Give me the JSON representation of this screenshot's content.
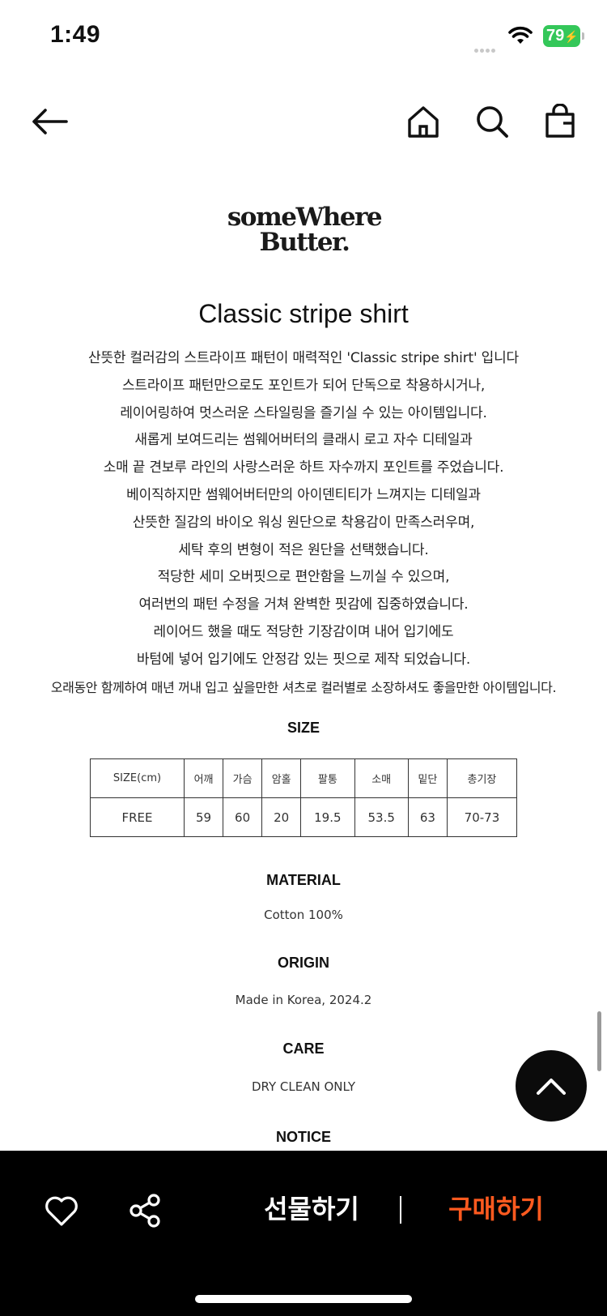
{
  "status": {
    "time": "1:49",
    "battery": "79"
  },
  "nav": {
    "back_icon": "back-arrow-icon",
    "home_icon": "home-icon",
    "search_icon": "search-icon",
    "bag_icon": "shopping-bag-icon"
  },
  "brand": {
    "line1": "someWhere",
    "line2": "Butter."
  },
  "product": {
    "title": "Classic stripe shirt"
  },
  "description": [
    "산뜻한 컬러감의 스트라이프 패턴이 매력적인 'Classic stripe shirt' 입니다",
    "스트라이프 패턴만으로도 포인트가 되어 단독으로 착용하시거나,",
    "레이어링하여 멋스러운 스타일링을 즐기실 수 있는 아이템입니다.",
    "새롭게 보여드리는 썸웨어버터의 클래시 로고 자수 디테일과",
    "소매 끝 견보루 라인의 사랑스러운 하트 자수까지 포인트를 주었습니다.",
    "베이직하지만 썸웨어버터만의 아이덴티티가 느껴지는 디테일과",
    "산뜻한 질감의 바이오 워싱 원단으로 착용감이 만족스러우며,",
    "세탁 후의 변형이 적은 원단을 선택했습니다.",
    "적당한 세미 오버핏으로 편안함을 느끼실 수 있으며,",
    "여러번의 패턴 수정을 거쳐 완벽한 핏감에 집중하였습니다.",
    "레이어드 했을 때도 적당한 기장감이며 내어 입기에도",
    "바텀에 넣어 입기에도 안정감 있는 핏으로 제작 되었습니다.",
    "오래동안 함께하여 매년 꺼내 입고 싶을만한 셔츠로 컬러별로 소장하셔도 좋을만한 아이템입니다."
  ],
  "size": {
    "heading": "SIZE",
    "headers": [
      "SIZE(cm)",
      "어깨",
      "가슴",
      "암홀",
      "팔통",
      "소매",
      "밑단",
      "총기장"
    ],
    "row": [
      "FREE",
      "59",
      "60",
      "20",
      "19.5",
      "53.5",
      "63",
      "70-73"
    ]
  },
  "material": {
    "heading": "MATERIAL",
    "value": "Cotton 100%"
  },
  "origin": {
    "heading": "ORIGIN",
    "value": "Made in Korea, 2024.2"
  },
  "care": {
    "heading": "CARE",
    "value": "DRY CLEAN ONLY"
  },
  "notice": {
    "heading": "NOTICE"
  },
  "bottom_bar": {
    "like_icon": "heart-icon",
    "share_icon": "share-icon",
    "gift_label": "선물하기",
    "buy_label": "구매하기"
  },
  "colors": {
    "buy": "#ff5a1f",
    "bar": "#000000",
    "battery": "#34c759"
  }
}
